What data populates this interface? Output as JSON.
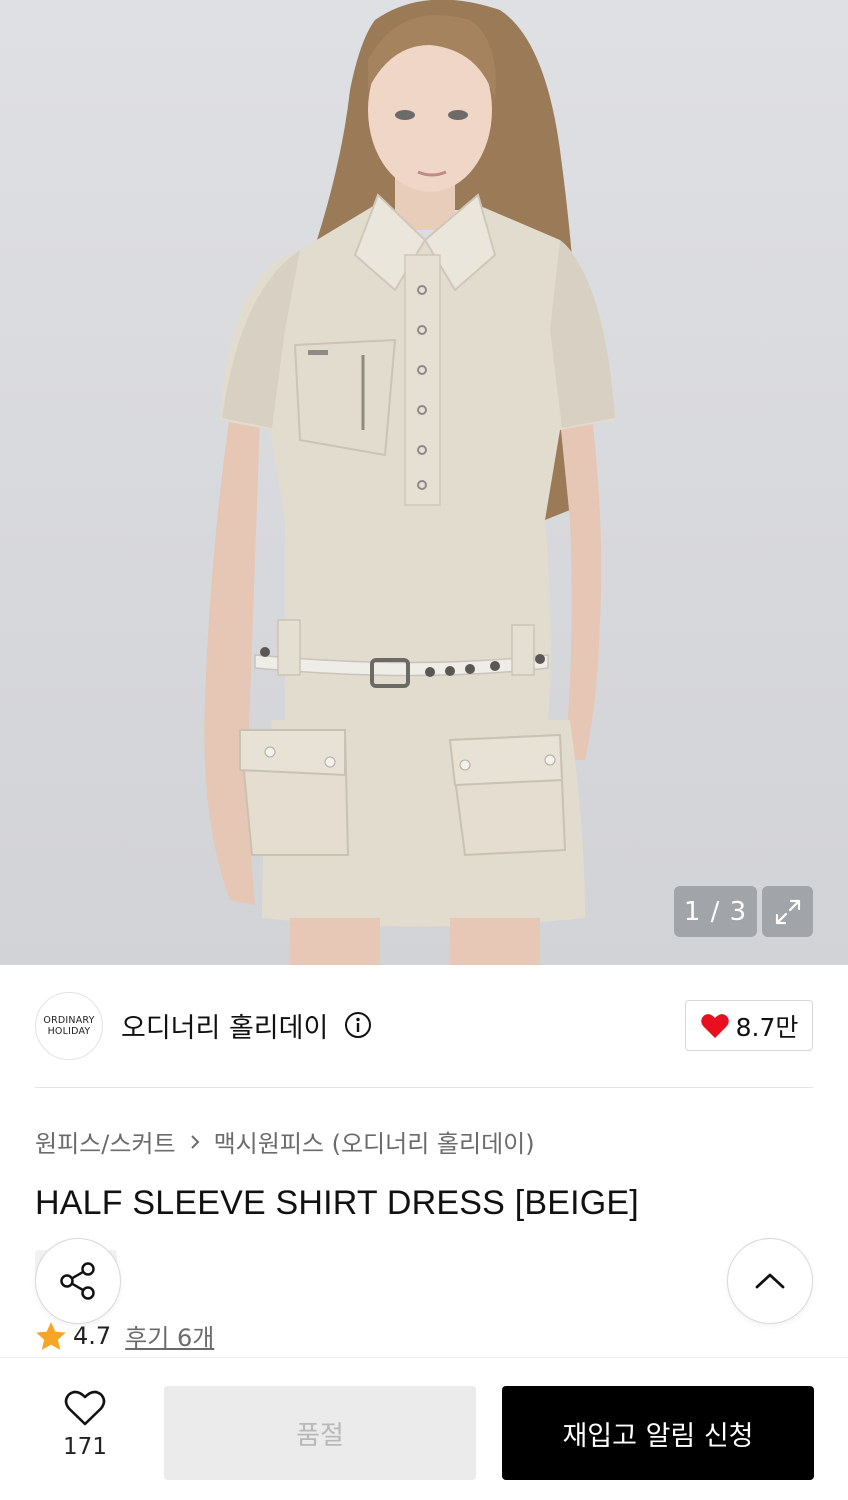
{
  "gallery": {
    "counter": "1 / 3",
    "expand_icon": "expand-arrows-icon"
  },
  "brand": {
    "logo_line1": "ORDINARY",
    "logo_line2": "HOLIDAY",
    "name": "오디너리 홀리데이",
    "info_icon": "info-circle-icon",
    "likes": "8.7만",
    "like_icon": "heart-filled-icon",
    "like_color": "#e8101f"
  },
  "breadcrumb": {
    "category": "원피스/스커트",
    "subcategory": "맥시원피스 (오디너리 홀리데이)"
  },
  "product": {
    "title": "HALF SLEEVE SHIRT DRESS [BEIGE]"
  },
  "rating": {
    "score": "4.7",
    "reviews": "후기 6개",
    "star_color": "#f5a623"
  },
  "floating": {
    "share_icon": "share-icon",
    "top_icon": "chevron-up-icon"
  },
  "bottom_bar": {
    "wish_count": "171",
    "soldout_label": "품절",
    "restock_label": "재입고 알림 신청"
  }
}
